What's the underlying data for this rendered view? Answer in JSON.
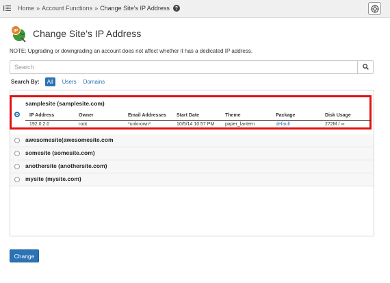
{
  "breadcrumb": {
    "home": "Home",
    "section": "Account Functions",
    "current": "Change Site’s IP Address",
    "separator": "»"
  },
  "page": {
    "title": "Change Site’s IP Address",
    "note": "NOTE: Upgrading or downgrading an account does not affect whether it has a dedicated IP address."
  },
  "search": {
    "placeholder": "Search",
    "value": ""
  },
  "search_by": {
    "label": "Search By:",
    "options": [
      "All",
      "Users",
      "Domains"
    ],
    "active": "All"
  },
  "accounts": [
    {
      "name": "samplesite (samplesite.com)",
      "selected": true
    },
    {
      "name": "awesomesite(awesomesite.com",
      "selected": false
    },
    {
      "name": "somesite (somesite.com)",
      "selected": false
    },
    {
      "name": "anothersite (anothersite.com)",
      "selected": false
    },
    {
      "name": "mysite (mysite.com)",
      "selected": false
    }
  ],
  "details": {
    "columns": [
      "IP Address",
      "Owner",
      "Email Addresses",
      "Start Date",
      "Theme",
      "Package",
      "Disk Usage"
    ],
    "row": {
      "ip": "192.0.2.0",
      "owner": "root",
      "email": "*unknown*",
      "start_date": "10/5/14 10:57 PM",
      "theme": "paper_lantern",
      "package": "default",
      "disk_usage": "272M / ∞"
    }
  },
  "actions": {
    "change_label": "Change"
  },
  "colors": {
    "accent": "#2a73b5",
    "highlight_border": "#e01010",
    "help_icon": "#444444"
  },
  "icons": {
    "menu": "menu-arrow-icon",
    "help": "help-icon",
    "corner": "lifebuoy-icon",
    "search": "search-icon",
    "app": "ip-address-icon"
  },
  "help_glyph": "?"
}
